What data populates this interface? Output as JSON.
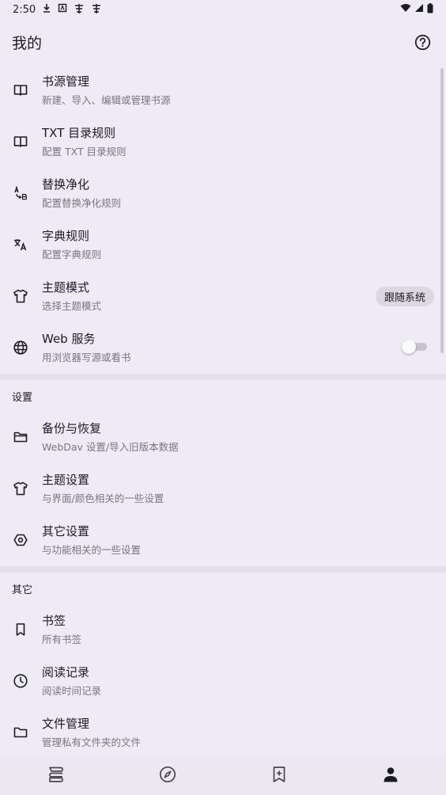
{
  "status_bar": {
    "time": "2:50",
    "icons": [
      "download-icon",
      "notification-icon",
      "app-icon",
      "app-icon"
    ],
    "right_icons": [
      "wifi-icon",
      "signal-icon",
      "battery-icon"
    ]
  },
  "app_bar": {
    "title": "我的",
    "help_icon": "help-icon"
  },
  "main_items": [
    {
      "title": "书源管理",
      "subtitle": "新建、导入、编辑或管理书源",
      "icon": "book-icon"
    },
    {
      "title": "TXT 目录规则",
      "subtitle": "配置 TXT 目录规则",
      "icon": "book-icon"
    },
    {
      "title": "替换净化",
      "subtitle": "配置替换净化规则",
      "icon": "replace-icon"
    },
    {
      "title": "字典规则",
      "subtitle": "配置字典规则",
      "icon": "translate-icon"
    },
    {
      "title": "主题模式",
      "subtitle": "选择主题模式",
      "icon": "shirt-icon",
      "chip": "跟随系统"
    },
    {
      "title": "Web 服务",
      "subtitle": "用浏览器写源或看书",
      "icon": "globe-icon",
      "toggle": false
    }
  ],
  "settings_section": {
    "header": "设置",
    "items": [
      {
        "title": "备份与恢复",
        "subtitle": "WebDav 设置/导入旧版本数据",
        "icon": "folder-open-icon"
      },
      {
        "title": "主题设置",
        "subtitle": "与界面/颜色相关的一些设置",
        "icon": "shirt-icon"
      },
      {
        "title": "其它设置",
        "subtitle": "与功能相关的一些设置",
        "icon": "settings-icon"
      }
    ]
  },
  "other_section": {
    "header": "其它",
    "items": [
      {
        "title": "书签",
        "subtitle": "所有书签",
        "icon": "bookmark-icon"
      },
      {
        "title": "阅读记录",
        "subtitle": "阅读时间记录",
        "icon": "clock-icon"
      },
      {
        "title": "文件管理",
        "subtitle": "管理私有文件夹的文件",
        "icon": "folder-icon"
      }
    ]
  },
  "bottom_nav": {
    "items": [
      "bookshelf-icon",
      "explore-icon",
      "rss-bookmark-icon",
      "profile-icon"
    ],
    "active": "profile-icon"
  },
  "colors": {
    "background": "#efebf6",
    "text": "#1c1b1f",
    "subtext": "#79767d"
  }
}
